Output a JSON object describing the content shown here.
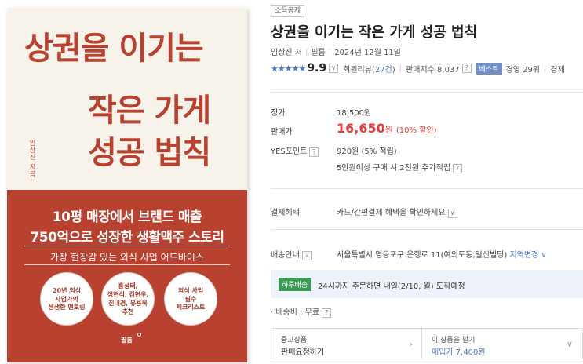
{
  "cover": {
    "title_line1": "상권을 이기는",
    "title_line2": "작은 가게",
    "title_line3": "성공 법칙",
    "author_vertical": "임상진 지음",
    "subtitle_line1": "10평 매장에서 브랜드 매출",
    "subtitle_line2": "750억으로 성장한 생활맥주 스토리",
    "tagline": "가장 현장감 있는 외식 사업 어드바이스",
    "circle1": "20년 외식\n사업가의\n생생한 멘토링",
    "circle2": "홍성태,\n정현식, 김현우,\n진내경, 유용욱\n추천",
    "circle3": "외식 사업\n필수\n체크리스트",
    "publisher": "필름"
  },
  "product": {
    "badge": "소득공제",
    "title": "상권을 이기는 작은 가게 성공 법칙",
    "author": "임상진 저",
    "publisher": "필름",
    "pub_date": "2024년 12월 11일",
    "stars": "★★★★★",
    "score": "9.9",
    "review_label": "회원리뷰(",
    "review_count": "27건",
    "review_close": ")",
    "sales_index": "판매지수 8,037",
    "best_badge": "베스트",
    "rank": "경영 29위",
    "rank_more": "경제"
  },
  "pricing": {
    "list_label": "정가",
    "list_price": "18,500원",
    "sale_label": "판매가",
    "sale_price": "16,650",
    "sale_unit": "원",
    "sale_rate": "(10% 할인)",
    "points_label": "YES포인트",
    "points_value": "920원 (5% 적립)",
    "points_extra": "5만원이상 구매 시 2천원 추가적립"
  },
  "benefits": {
    "label": "결제혜택",
    "value": "카드/간편결제 혜택을 확인하세요"
  },
  "delivery": {
    "label": "배송안내",
    "address": "서울특별시 영등포구 은행로 11(여의도동,일신빌딩)",
    "region_link": "지역변경",
    "today_badge": "하루배송",
    "today_text": "24시까지 주문하면 내일(2/10, 월) 도착예정",
    "shipping_fee": "· 배송비 : 무료"
  },
  "used": {
    "left_line1": "중고상품",
    "left_line2": "판매요청하기",
    "right_line1": "이 상품을 팔기",
    "right_line2": "매입가 7,400원"
  },
  "colors": {
    "brand_red": "#b8412f",
    "sale_red": "#e53d3d",
    "link_blue": "#4b78c8",
    "today_green": "#3a9a55"
  }
}
